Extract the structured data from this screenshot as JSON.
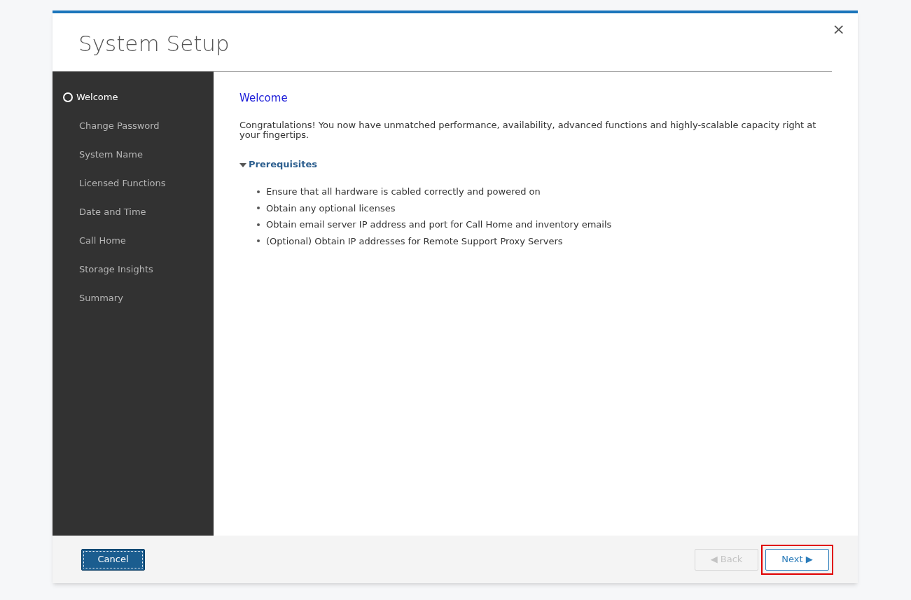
{
  "window": {
    "title": "System Setup",
    "close": "×"
  },
  "sidebar": {
    "items": [
      {
        "label": "Welcome",
        "selected": true
      },
      {
        "label": "Change Password",
        "selected": false
      },
      {
        "label": "System Name",
        "selected": false
      },
      {
        "label": "Licensed Functions",
        "selected": false
      },
      {
        "label": "Date and Time",
        "selected": false
      },
      {
        "label": "Call Home",
        "selected": false
      },
      {
        "label": "Storage Insights",
        "selected": false
      },
      {
        "label": "Summary",
        "selected": false
      }
    ]
  },
  "content": {
    "heading": "Welcome",
    "intro": "Congratulations! You now have unmatched performance, availability, advanced functions and highly-scalable capacity right at your fingertips.",
    "section": {
      "title": "Prerequisites",
      "expanded": true,
      "items": [
        "Ensure that all hardware is cabled correctly and powered on",
        "Obtain any optional licenses",
        "Obtain email server IP address and port for Call Home and inventory emails",
        "(Optional) Obtain IP addresses for Remote Support Proxy Servers"
      ]
    }
  },
  "footer": {
    "buttons": [
      {
        "label": "Cancel",
        "kind": "primary",
        "disabled": false,
        "highlighted": false
      },
      {
        "label": "◀ Back",
        "kind": "secondary",
        "disabled": true,
        "highlighted": false
      },
      {
        "label": "Next ▶",
        "kind": "secondary",
        "disabled": false,
        "highlighted": true
      }
    ]
  }
}
